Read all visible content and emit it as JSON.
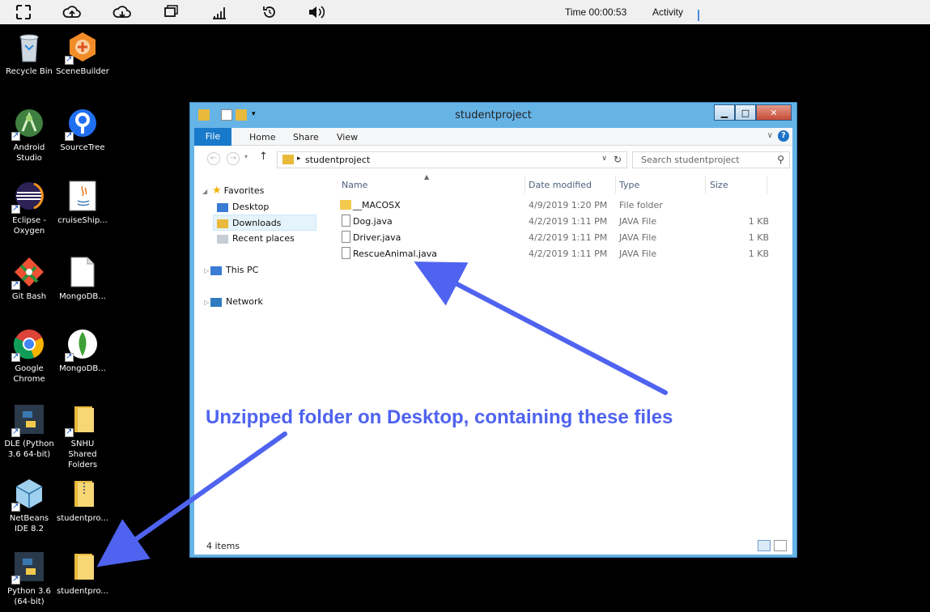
{
  "toolbar": {
    "icons": [
      "fullscreen-icon",
      "upload-icon",
      "download-icon",
      "window-icon",
      "signal-icon",
      "refresh-icon",
      "volume-icon"
    ],
    "time": "Time 00:00:53",
    "activity": "Activity"
  },
  "desktop": {
    "icons": [
      {
        "label": "Recycle Bin",
        "icon": "recycle-bin-icon"
      },
      {
        "label": "SceneBuilder",
        "icon": "scenebuilder-icon"
      },
      {
        "label": "Android Studio",
        "icon": "android-studio-icon"
      },
      {
        "label": "SourceTree",
        "icon": "sourcetree-icon"
      },
      {
        "label": "Eclipse - Oxygen",
        "icon": "eclipse-icon"
      },
      {
        "label": "cruiseShip...",
        "icon": "java-icon"
      },
      {
        "label": "Git Bash",
        "icon": "git-bash-icon"
      },
      {
        "label": "MongoDB...",
        "icon": "document-icon"
      },
      {
        "label": "Google Chrome",
        "icon": "chrome-icon"
      },
      {
        "label": "MongoDB...",
        "icon": "mongodb-icon"
      },
      {
        "label": "DLE (Python 3.6 64-bit)",
        "icon": "python-idle-icon"
      },
      {
        "label": "SNHU Shared Folders",
        "icon": "folder-icon"
      },
      {
        "label": "NetBeans IDE 8.2",
        "icon": "netbeans-icon"
      },
      {
        "label": "studentpro...",
        "icon": "zip-folder-icon"
      },
      {
        "label": "Python 3.6 (64-bit)",
        "icon": "python-icon"
      },
      {
        "label": "studentpro...",
        "icon": "folder-icon"
      }
    ]
  },
  "window": {
    "title": "studentproject",
    "ribbon_tabs": [
      "File",
      "Home",
      "Share",
      "View"
    ],
    "address": "studentproject",
    "search_placeholder": "Search studentproject",
    "nav": {
      "favorites": "Favorites",
      "desktop": "Desktop",
      "downloads": "Downloads",
      "recent": "Recent places",
      "this_pc": "This PC",
      "network": "Network"
    },
    "columns": [
      "Name",
      "Date modified",
      "Type",
      "Size"
    ],
    "files": [
      {
        "name": "__MACOSX",
        "date": "4/9/2019 1:20 PM",
        "type": "File folder",
        "size": ""
      },
      {
        "name": "Dog.java",
        "date": "4/2/2019 1:11 PM",
        "type": "JAVA File",
        "size": "1 KB"
      },
      {
        "name": "Driver.java",
        "date": "4/2/2019 1:11 PM",
        "type": "JAVA File",
        "size": "1 KB"
      },
      {
        "name": "RescueAnimal.java",
        "date": "4/2/2019 1:11 PM",
        "type": "JAVA File",
        "size": "1 KB"
      }
    ],
    "status": "4 items"
  },
  "annotation": {
    "text": "Unzipped folder on Desktop, containing these files",
    "color": "#4f63f0"
  },
  "colors": {
    "window_frame": "#66b3e6",
    "file_tab": "#1979ca",
    "desktop_bg": "#000000"
  }
}
